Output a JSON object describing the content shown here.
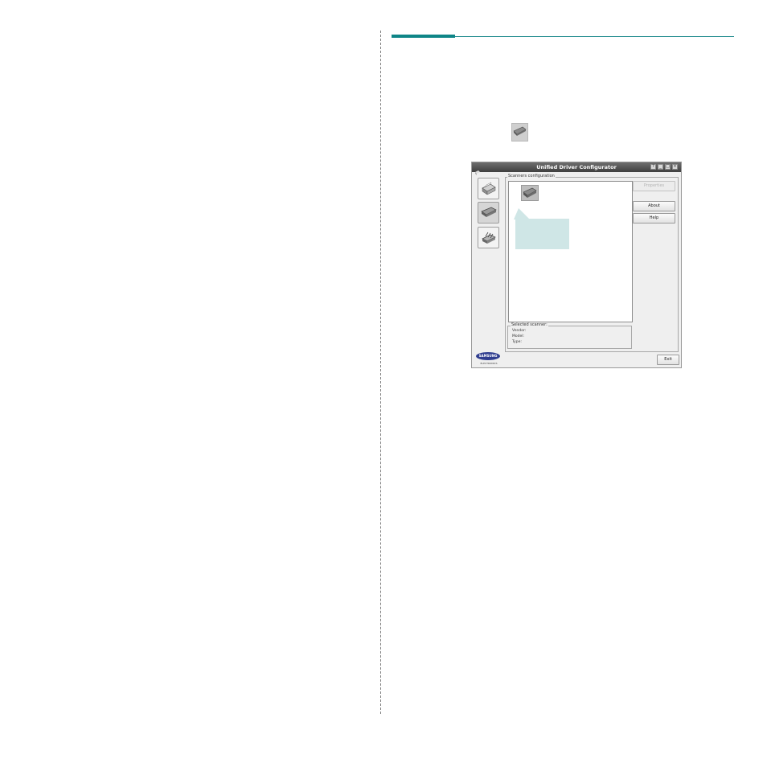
{
  "window": {
    "title": "Unified Driver Configurator",
    "controls": {
      "help": "?",
      "minimize": "_",
      "maximize": "□",
      "close": "×"
    }
  },
  "nav": [
    {
      "name": "printers-configuration",
      "icon": "printer-icon",
      "active": false
    },
    {
      "name": "scanners-configuration",
      "icon": "scanner-icon",
      "active": true
    },
    {
      "name": "ports-configuration",
      "icon": "port-icon",
      "active": false
    }
  ],
  "scanners": {
    "group_label": "Scanners configuration",
    "items": [
      {
        "icon": "scanner-icon",
        "selected": true
      }
    ]
  },
  "buttons": {
    "properties": "Properties",
    "about": "About",
    "help": "Help",
    "exit": "Exit"
  },
  "selected_scanner": {
    "label": "Selected scanner:",
    "vendor_label": "Vendor:",
    "model_label": "Model:",
    "type_label": "Type:"
  },
  "branding": {
    "logo_text": "SAMSUNG",
    "tagline": "ELECTRONICS"
  },
  "colors": {
    "accent": "#0e8587",
    "callout": "#cfe6e6",
    "titlebar": "#4f4f4f"
  }
}
